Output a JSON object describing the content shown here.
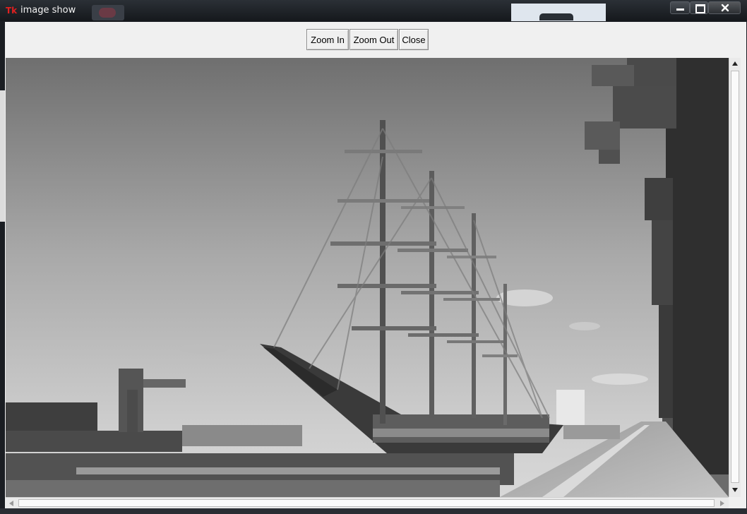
{
  "window": {
    "app_badge": "Tk",
    "title": "image show"
  },
  "toolbar": {
    "zoom_in_label": "Zoom In",
    "zoom_out_label": "Zoom Out",
    "close_label": "Close"
  },
  "image": {
    "subject": "grayscale photo of a tall ship docked at a quay",
    "mode": "grayscale"
  },
  "icons": {
    "minimize": "minimize-icon",
    "maximize": "maximize-icon",
    "close": "close-icon",
    "scroll_up": "arrow-up-icon",
    "scroll_down": "arrow-down-icon",
    "scroll_left": "arrow-left-icon",
    "scroll_right": "arrow-right-icon"
  }
}
